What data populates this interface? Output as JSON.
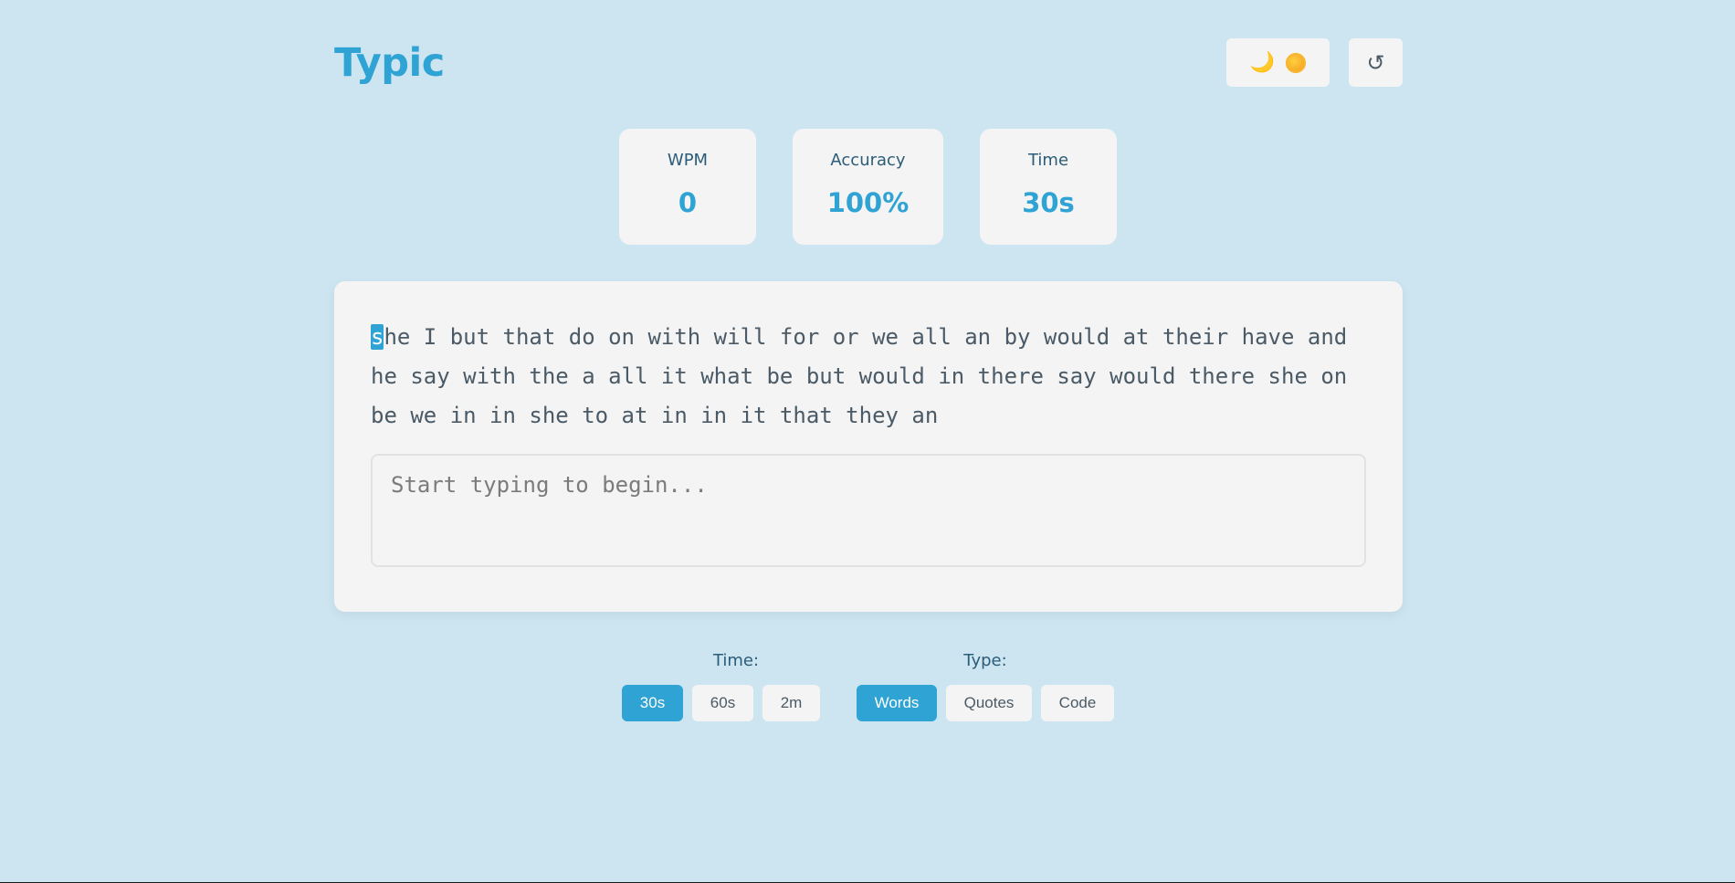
{
  "app": {
    "title": "Typic"
  },
  "header": {
    "theme_icons": [
      "moon-icon",
      "sun-icon"
    ],
    "restart_symbol": "↺"
  },
  "stats": [
    {
      "label": "WPM",
      "value": "0"
    },
    {
      "label": "Accuracy",
      "value": "100%"
    },
    {
      "label": "Time",
      "value": "30s"
    }
  ],
  "typing": {
    "current_char": "s",
    "line1_rest": "he I but that do on with will for or we all an by would at their have and",
    "line2": "he say with the a all it what be but would in there say would there she on",
    "line3": "be we in in she to at in in it that they an",
    "placeholder": "Start typing to begin..."
  },
  "options": {
    "time_label": "Time:",
    "time_buttons": [
      "30s",
      "60s",
      "2m"
    ],
    "time_selected": "30s",
    "type_label": "Type:",
    "type_buttons": [
      "Words",
      "Quotes",
      "Code"
    ],
    "type_selected": "Words"
  },
  "colors": {
    "background": "#cde5f1",
    "accent": "#2ea3d4",
    "card": "#f4f4f4"
  }
}
